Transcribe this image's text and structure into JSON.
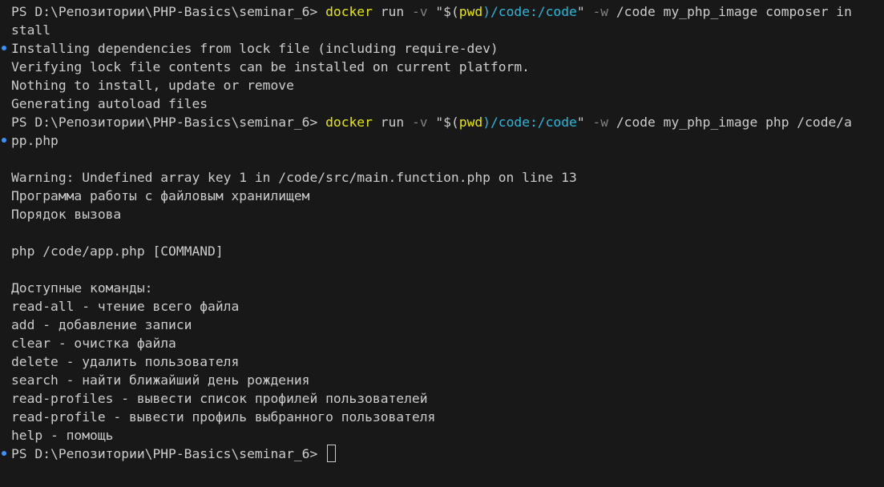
{
  "terminal": {
    "prompt": "PS D:\\Репозитории\\PHP-Basics\\seminar_6> ",
    "cmd1": {
      "exe": "docker",
      "sub": " run ",
      "flag1": "-v",
      "q_open": " \"$(",
      "pwd": "pwd",
      "vol": ")/code:/code",
      "q_close": "\" ",
      "flag2": "-w",
      "rest_first": " /code my_php_image composer in",
      "rest_wrap": "stall"
    },
    "output1": [
      "Installing dependencies from lock file (including require-dev)",
      "Verifying lock file contents can be installed on current platform.",
      "Nothing to install, update or remove",
      "Generating autoload files"
    ],
    "cmd2": {
      "exe": "docker",
      "sub": " run ",
      "flag1": "-v",
      "q_open": " \"$(",
      "pwd": "pwd",
      "vol": ")/code:/code",
      "q_close": "\" ",
      "flag2": "-w",
      "rest_first": " /code my_php_image php /code/a",
      "rest_wrap": "pp.php"
    },
    "output2": [
      "",
      "Warning: Undefined array key 1 in /code/src/main.function.php on line 13",
      "Программа работы с файловым хранилищем",
      "Порядок вызова",
      "",
      "php /code/app.php [COMMAND]",
      "",
      "Доступные команды:",
      "read-all - чтение всего файла",
      "add - добавление записи",
      "clear - очистка файла",
      "delete - удалить пользователя",
      "search - найти ближайший день рождения",
      "read-profiles - вывести список профилей пользователей",
      "read-profile - вывести профиль выбранного пользователя",
      "help - помощь"
    ],
    "final_prompt": "PS D:\\Репозитории\\PHP-Basics\\seminar_6> "
  },
  "colors": {
    "background": "#181818",
    "text": "#cccccc",
    "command": "#e5e510",
    "flag": "#808080",
    "path": "#29b8db",
    "marker": "#3794ff"
  }
}
